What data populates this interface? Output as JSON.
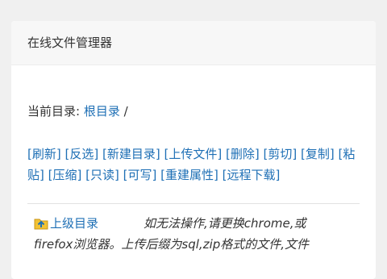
{
  "panel": {
    "title": "在线文件管理器"
  },
  "current_dir": {
    "label": "当前目录: ",
    "root_link": "根目录",
    "separator": " /"
  },
  "actions": [
    "[刷新]",
    "[反选]",
    "[新建目录]",
    "[上传文件]",
    "[删除]",
    "[剪切]",
    "[复制]",
    "[粘贴]",
    "[压缩]",
    "[只读]",
    "[可写]",
    "[重建属性]",
    "[远程下载]"
  ],
  "parent": {
    "link": "上级目录",
    "note_line1": "如无法操作,请更换chrome,或",
    "note_line2": "firefox浏览器。上传后缀为sql,zip格式的文件,文件"
  },
  "colors": {
    "link": "#1e6fb5",
    "panel_header": "#f7f7f7"
  },
  "icons": {
    "parent_dir": "folder-up-icon"
  }
}
